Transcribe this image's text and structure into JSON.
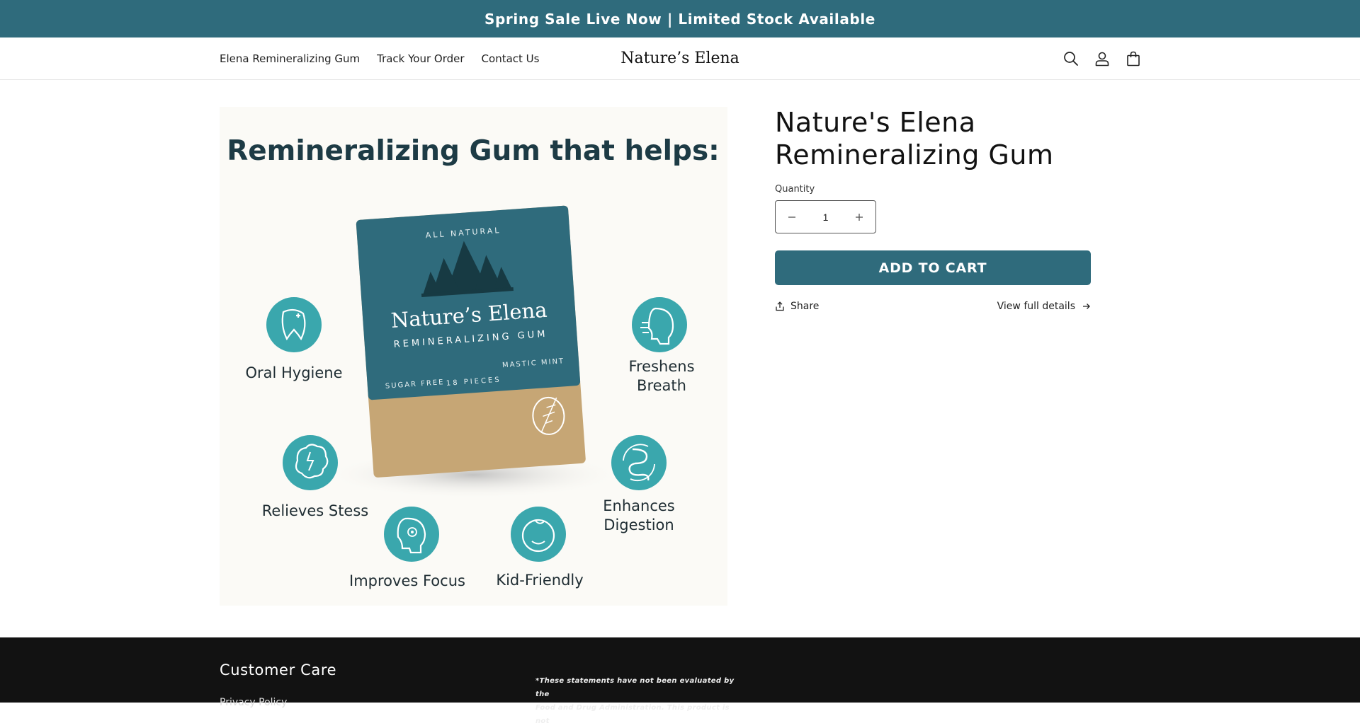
{
  "announcement": {
    "text": "Spring Sale Live Now | Limited Stock Available"
  },
  "header": {
    "nav": [
      "Elena Remineralizing Gum",
      "Track Your Order",
      "Contact Us"
    ],
    "logo": "Nature’s Elena",
    "icons": [
      "search-icon",
      "account-icon",
      "cart-icon"
    ]
  },
  "product": {
    "image": {
      "headline": "Remineralizing Gum that helps:",
      "box": {
        "top": "ALL NATURAL",
        "brand": "Nature’s Elena",
        "product": "REMINERALIZING GUM",
        "left": "SUGAR FREE",
        "center": "18 PIECES",
        "right": "MASTIC MINT"
      },
      "benefits": {
        "oral": "Oral Hygiene",
        "breath_1": "Freshens",
        "breath_2": "Breath",
        "stress": "Relieves Stess",
        "digestion_1": "Enhances",
        "digestion_2": "Digestion",
        "focus": "Improves Focus",
        "kid": "Kid-Friendly"
      }
    },
    "title_line1": "Nature's Elena",
    "title_line2": "Remineralizing Gum",
    "quantity_label": "Quantity",
    "quantity_value": "1",
    "add_to_cart": "ADD TO CART",
    "share": "Share",
    "view_details": "View full details"
  },
  "footer": {
    "heading": "Customer Care",
    "link": "Privacy Policy",
    "disclaimer_line1": "*These statements have not been evaluated by the",
    "disclaimer_line2": "Food and Drug Administration. This product is not"
  },
  "colors": {
    "brand": "#2f6b7c",
    "teal_icon": "#3aa7ad",
    "footer_bg": "#121212"
  }
}
